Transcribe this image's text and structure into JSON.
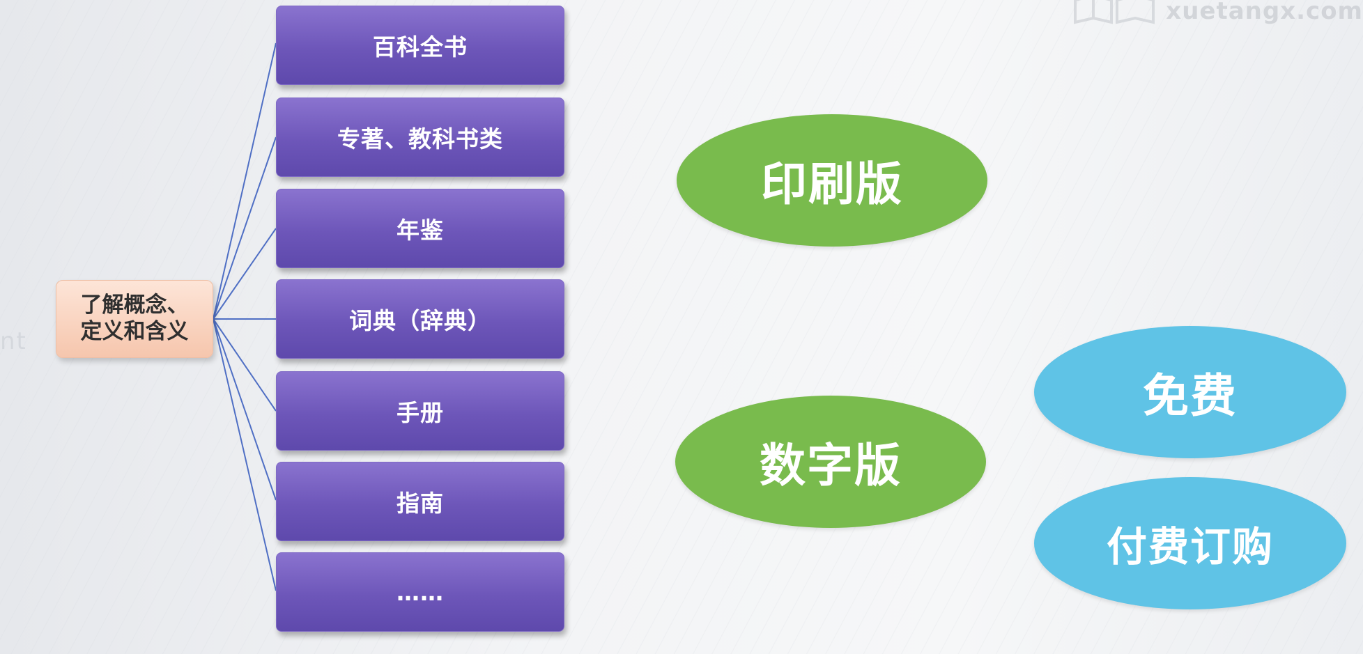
{
  "watermark": {
    "text": "xuetangx.com",
    "icon": "book-logo-icon"
  },
  "diagram": {
    "root": {
      "line1": "了解概念、",
      "line2": "定义和含义"
    },
    "categories": [
      "百科全书",
      "专著、教科书类",
      "年鉴",
      "词典（辞典）",
      "手册",
      "指南",
      "……"
    ],
    "formats": {
      "print": "印刷版",
      "digital": "数字版"
    },
    "access": {
      "free": "免费",
      "paid": "付费订购"
    }
  },
  "colors": {
    "category_fill": "#6d56b9",
    "root_fill": "#f6c6ad",
    "format_fill": "#79bb4d",
    "access_fill": "#5fc3e6",
    "connector": "#4f6fc4"
  }
}
